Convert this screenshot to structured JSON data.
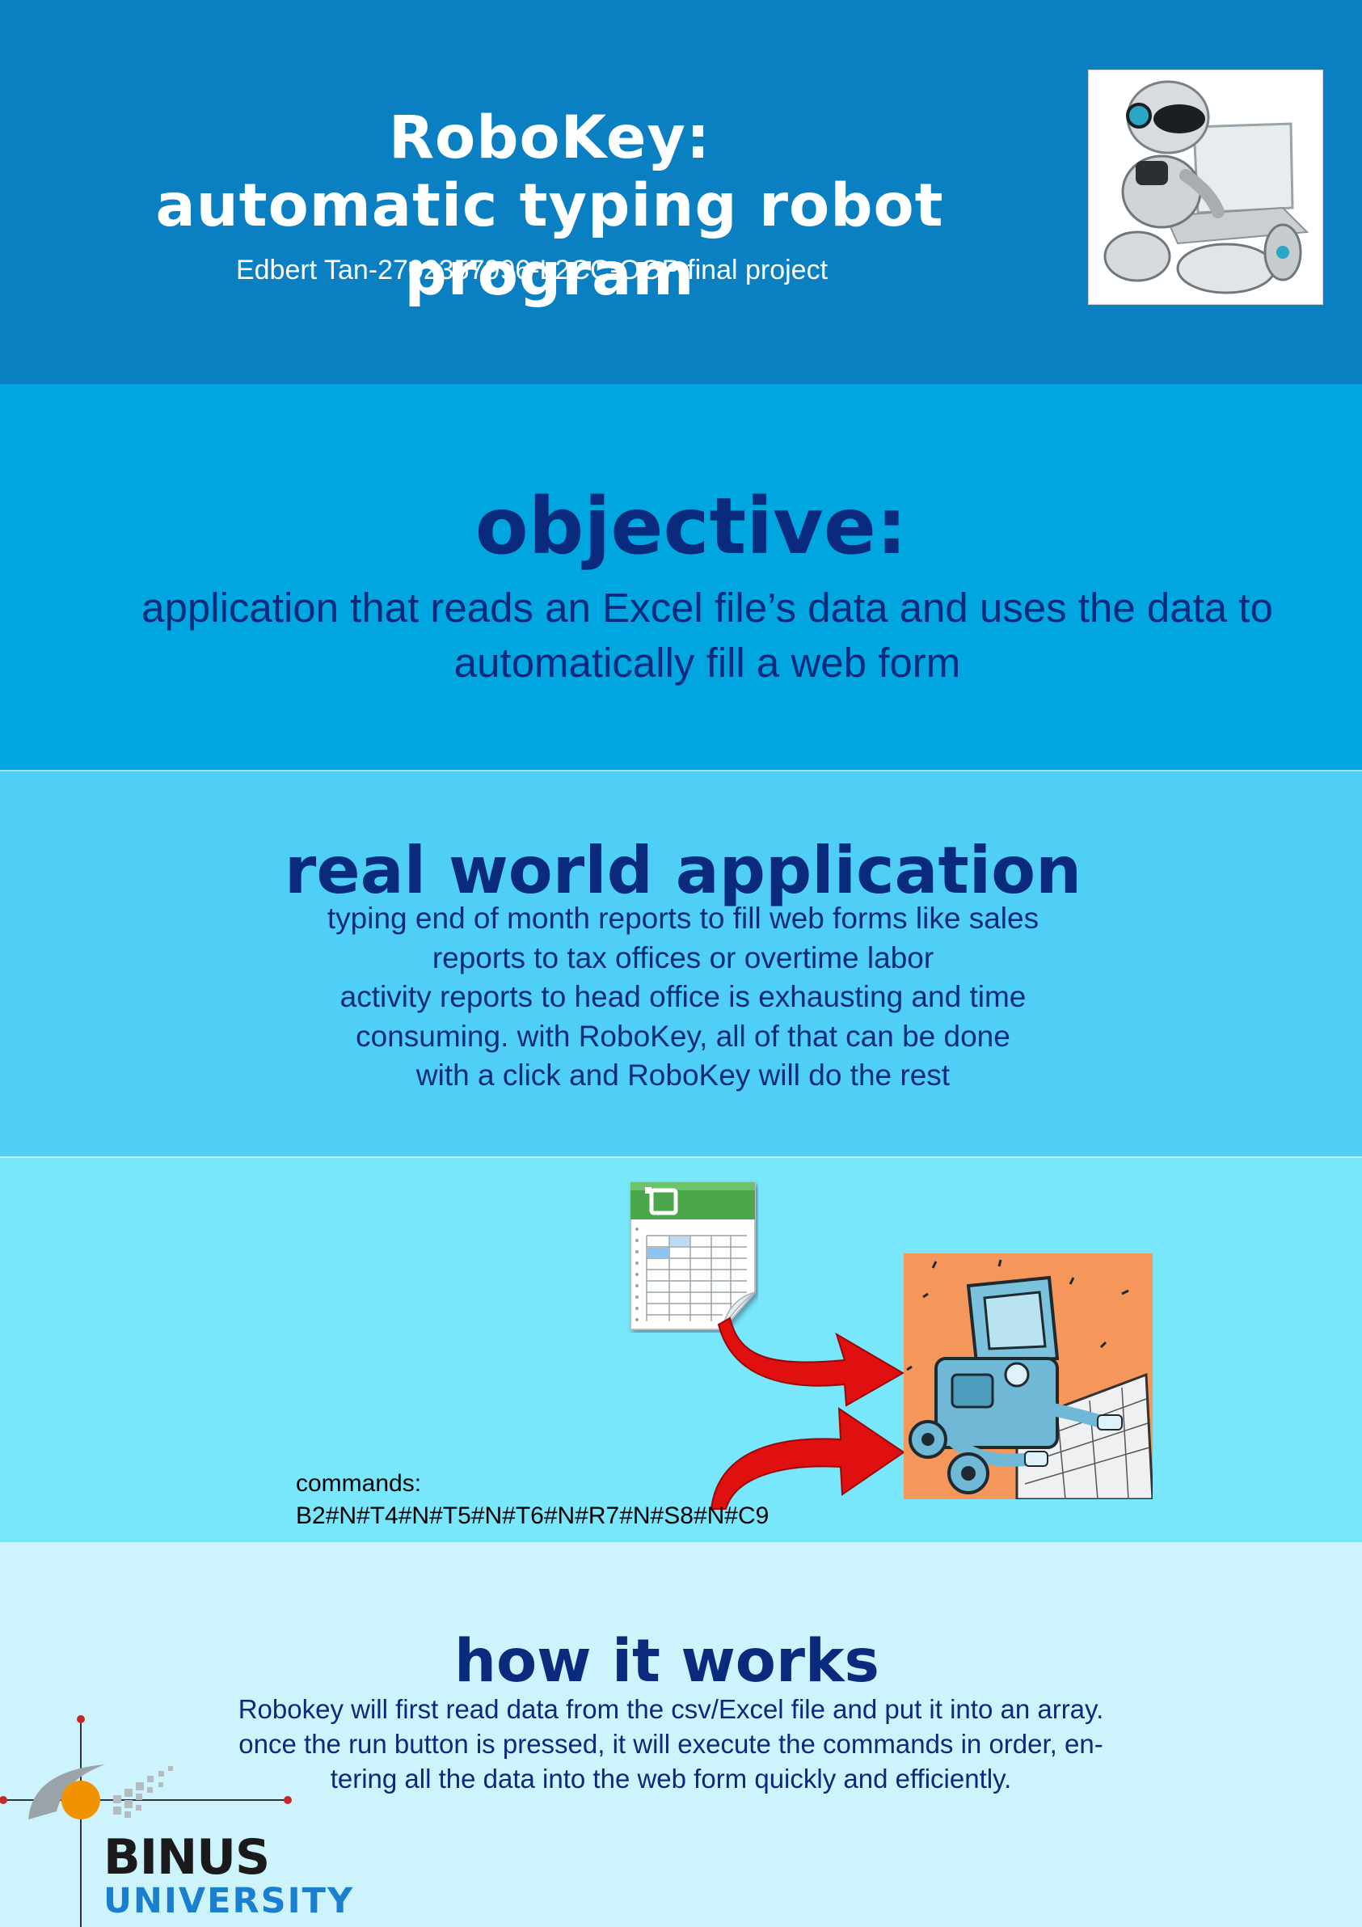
{
  "header": {
    "title_line1": "RoboKey:",
    "title_line2": "automatic typing robot program",
    "subtitle": "Edbert Tan-2702357996-L2CC-OOP final project"
  },
  "objective": {
    "heading": "objective:",
    "text": "application that reads an Excel file’s data and uses the data to automatically fill a web form"
  },
  "real_world": {
    "heading": "real world application",
    "lines": [
      "typing end of month reports to fill web forms like sales",
      "reports to tax offices or overtime labor",
      "activity reports to head office is exhausting and time",
      "consuming. with RoboKey, all of that can be done",
      "with a click and RoboKey will do the rest"
    ]
  },
  "diagram": {
    "commands_label": "commands:",
    "commands_value": "B2#N#T4#N#T5#N#T6#N#R7#N#S8#N#C9"
  },
  "how_it_works": {
    "heading": "how it works",
    "lines": [
      "Robokey will first read data from the csv/Excel file and put it into an array.",
      "once the run button is pressed, it will execute the commands in order, en-",
      "tering all the data into the web form quickly and efficiently."
    ]
  },
  "logo": {
    "name": "BINUS",
    "sub": "UNIVERSITY"
  },
  "colors": {
    "title_band": "#0a7fc2",
    "objective_band": "#00a6df",
    "realworld_band": "#4fcff6",
    "diagram_band": "#78e7fb",
    "howitworks_band": "#cdf4fc",
    "heading_text": "#0a2a7d",
    "arrow": "#e01010"
  }
}
